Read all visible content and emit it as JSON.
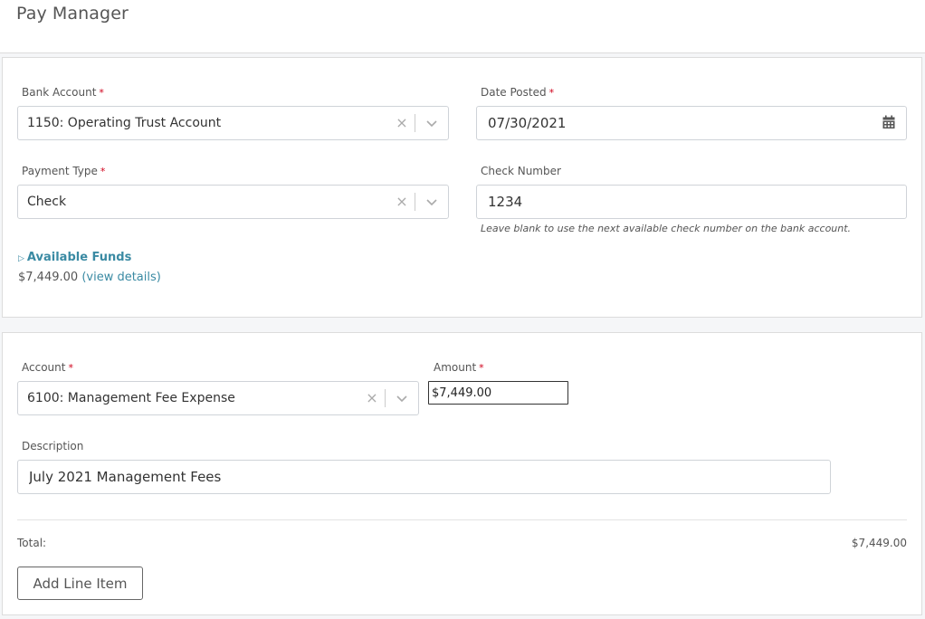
{
  "header": {
    "title": "Pay Manager"
  },
  "payment": {
    "bank_account": {
      "label": "Bank Account",
      "required_mark": "*",
      "value": "1150: Operating Trust Account",
      "clear_icon": "×"
    },
    "date_posted": {
      "label": "Date Posted",
      "required_mark": "*",
      "value": "07/30/2021",
      "icon": "calendar-icon"
    },
    "payment_type": {
      "label": "Payment Type",
      "required_mark": "*",
      "value": "Check",
      "clear_icon": "×"
    },
    "check_number": {
      "label": "Check Number",
      "value": "1234",
      "help": "Leave blank to use the next available check number on the bank account."
    },
    "available_funds": {
      "toggle_icon": "▷",
      "title": "Available Funds",
      "amount": "$7,449.00",
      "link": "(view details)"
    }
  },
  "line_item": {
    "account": {
      "label": "Account",
      "required_mark": "*",
      "value": "6100: Management Fee Expense",
      "clear_icon": "×"
    },
    "amount": {
      "label": "Amount",
      "required_mark": "*",
      "value": "$7,449.00"
    },
    "description": {
      "label": "Description",
      "value": "July 2021 Management Fees"
    }
  },
  "totals": {
    "label": "Total:",
    "value": "$7,449.00"
  },
  "actions": {
    "add_line_item": "Add Line Item"
  },
  "colors": {
    "accent": "#3a8aa3",
    "required": "#d0021b"
  }
}
